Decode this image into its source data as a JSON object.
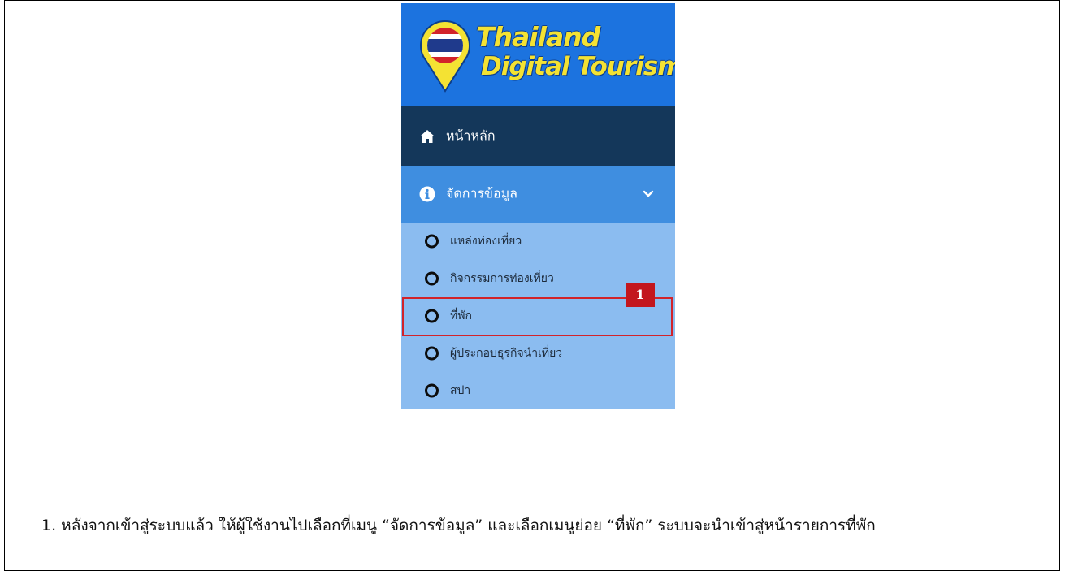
{
  "logo": {
    "line1": "Thailand",
    "line2": "Digital Tourism",
    "icon": "map-pin-flag-icon"
  },
  "menu": {
    "home": {
      "label": "หน้าหลัก",
      "icon": "home-icon"
    },
    "data_management": {
      "label": "จัดการข้อมูล",
      "icon": "info-circle-icon",
      "expanded": true
    }
  },
  "submenu": [
    {
      "label": "แหล่งท่องเที่ยว",
      "icon": "circle-outline-icon"
    },
    {
      "label": "กิจกรรมการท่องเที่ยว",
      "icon": "circle-outline-icon"
    },
    {
      "label": "ที่พัก",
      "icon": "circle-outline-icon",
      "highlighted": true
    },
    {
      "label": "ผู้ประกอบธุรกิจนำเที่ยว",
      "icon": "circle-outline-icon"
    },
    {
      "label": "สปา",
      "icon": "circle-outline-icon"
    }
  ],
  "callout": {
    "number": "1"
  },
  "instruction": "1. หลังจากเข้าสู่ระบบแล้ว ให้ผู้ใช้งานไปเลือกที่เมนู “จัดการข้อมูล” และเลือกเมนูย่อย “ที่พัก” ระบบจะนำเข้าสู่หน้ารายการที่พัก",
  "colors": {
    "logo_bg": "#1c73df",
    "home_bg": "#14375a",
    "data_menu_bg": "#3f8ee0",
    "submenu_bg": "#8bbcf0",
    "highlight": "#d2232a",
    "logo_text": "#f4e233"
  }
}
